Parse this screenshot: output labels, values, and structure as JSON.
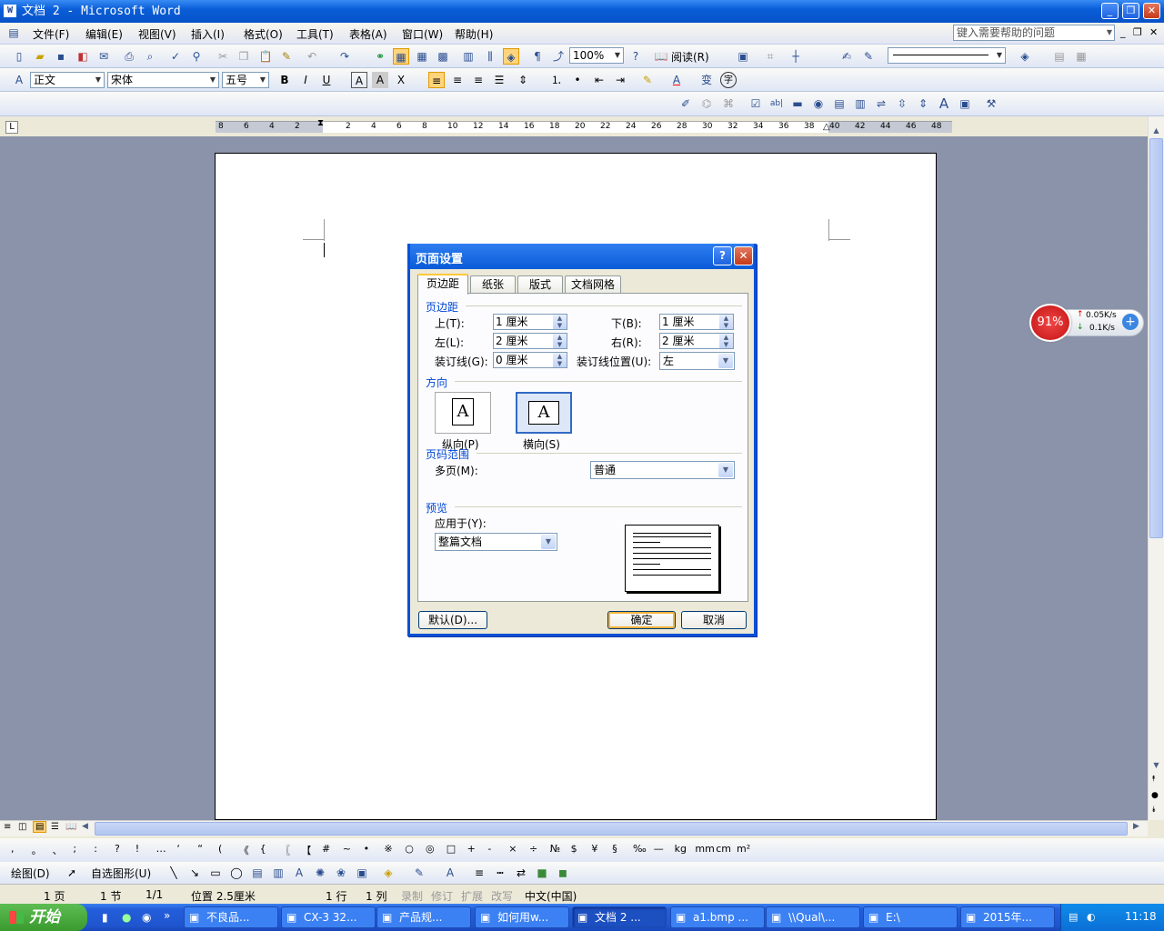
{
  "window": {
    "title": "文档 2 - Microsoft Word",
    "help_placeholder": "键入需要帮助的问题"
  },
  "menu": [
    "文件(F)",
    "编辑(E)",
    "视图(V)",
    "插入(I)",
    "格式(O)",
    "工具(T)",
    "表格(A)",
    "窗口(W)",
    "帮助(H)"
  ],
  "toolbar": {
    "zoom": "100%",
    "read_label": "阅读(R)",
    "style": "正文",
    "font": "宋体",
    "size": "五号"
  },
  "ruler": {
    "ticks": [
      "8",
      "6",
      "4",
      "2",
      "",
      "2",
      "4",
      "6",
      "8",
      "10",
      "12",
      "14",
      "16",
      "18",
      "20",
      "22",
      "24",
      "26",
      "28",
      "30",
      "32",
      "34",
      "36",
      "38",
      "40",
      "42",
      "44",
      "46",
      "48"
    ]
  },
  "dialog": {
    "title": "页面设置",
    "tabs": [
      "页边距",
      "纸张",
      "版式",
      "文档网格"
    ],
    "margins_group": "页边距",
    "top_label": "上(T):",
    "top_value": "1 厘米",
    "bottom_label": "下(B):",
    "bottom_value": "1 厘米",
    "left_label": "左(L):",
    "left_value": "2 厘米",
    "right_label": "右(R):",
    "right_value": "2 厘米",
    "gutter_label": "装订线(G):",
    "gutter_value": "0 厘米",
    "gutter_pos_label": "装订线位置(U):",
    "gutter_pos_value": "左",
    "orientation_group": "方向",
    "portrait_label": "纵向(P)",
    "landscape_label": "横向(S)",
    "pages_group": "页码范围",
    "multiple_pages_label": "多页(M):",
    "multiple_pages_value": "普通",
    "preview_group": "预览",
    "apply_label": "应用于(Y):",
    "apply_value": "整篇文档",
    "default_btn": "默认(D)...",
    "ok_btn": "确定",
    "cancel_btn": "取消"
  },
  "netwidget": {
    "percent": "91%",
    "up": "0.05K/s",
    "down": "0.1K/s"
  },
  "symbols": [
    ",",
    "。",
    "、",
    ";",
    ":",
    "?",
    "!",
    "…",
    "‘",
    "“",
    "(",
    "《",
    "{",
    "〖",
    "【",
    "#",
    "~",
    "•",
    "※",
    "○",
    "◎",
    "□",
    "+",
    "-",
    "×",
    "÷",
    "№",
    "$",
    "¥",
    "§",
    "‰",
    "—",
    "kg",
    "mm",
    "cm",
    "m²"
  ],
  "drawbar": {
    "draw": "绘图(D)",
    "autoshape": "自选图形(U)"
  },
  "status": {
    "page": "1 页",
    "section": "1 节",
    "pages": "1/1",
    "position": "位置 2.5厘米",
    "line": "1 行",
    "col": "1 列",
    "rec": "录制",
    "trk": "修订",
    "ext": "扩展",
    "ovr": "改写",
    "lang": "中文(中国)"
  },
  "taskbar": {
    "start": "开始",
    "tasks": [
      "不良品...",
      "CX-3 32...",
      "产品规...",
      "如何用w...",
      "文档 2 ...",
      "a1.bmp ...",
      "\\\\Qual\\...",
      "E:\\",
      "2015年..."
    ],
    "time": "11:18"
  }
}
